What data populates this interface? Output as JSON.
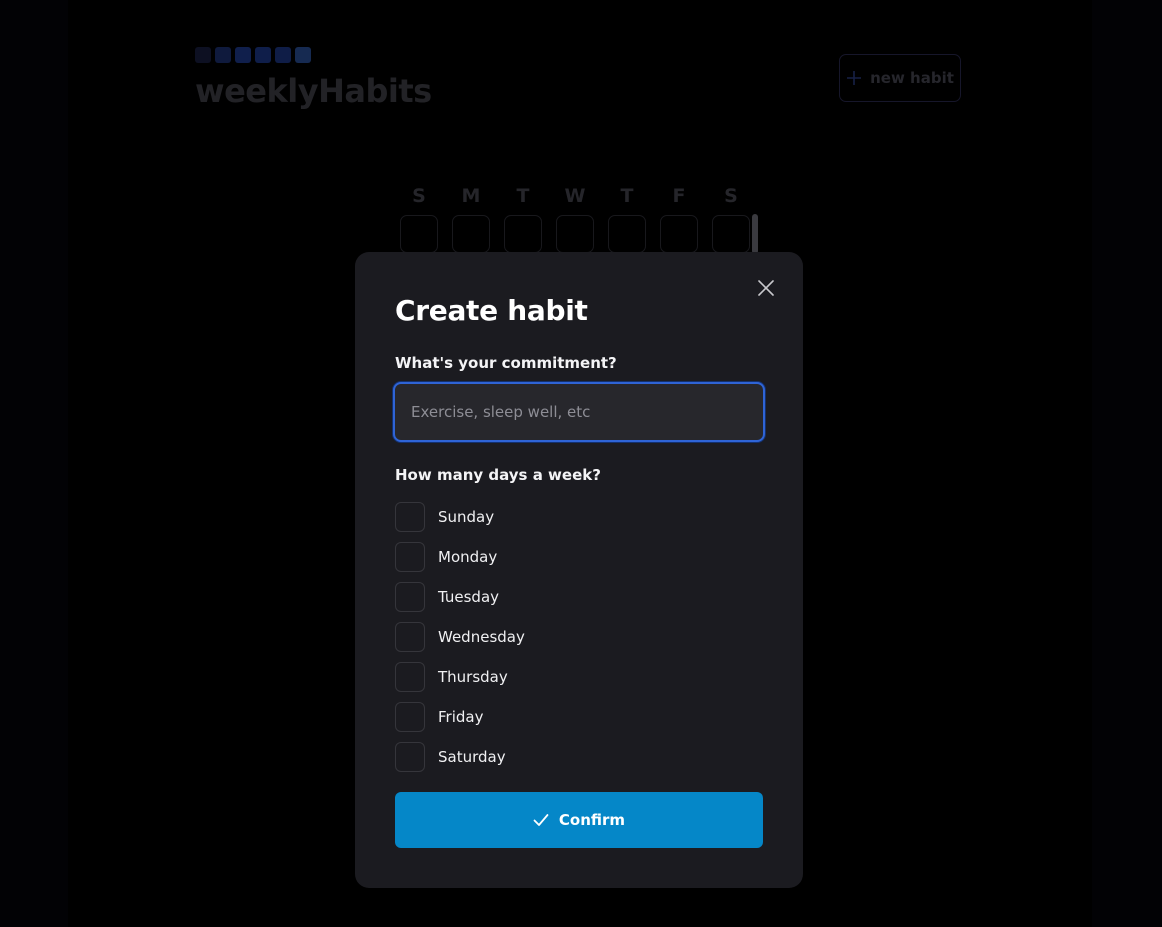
{
  "app": {
    "title": "weeklyHabits",
    "logo_square_colors": [
      "#0d1022",
      "#0f1a3d",
      "#101f4c",
      "#0f1e4a",
      "#0f1d47",
      "#162a51"
    ],
    "new_habit_label": "new habit"
  },
  "week_header": [
    "S",
    "M",
    "T",
    "W",
    "T",
    "F",
    "S"
  ],
  "modal": {
    "title": "Create habit",
    "commitment_label": "What's your commitment?",
    "commitment_value": "",
    "commitment_placeholder": "Exercise, sleep well, etc",
    "days_label": "How many days a week?",
    "days": [
      {
        "label": "Sunday",
        "checked": false
      },
      {
        "label": "Monday",
        "checked": false
      },
      {
        "label": "Tuesday",
        "checked": false
      },
      {
        "label": "Wednesday",
        "checked": false
      },
      {
        "label": "Thursday",
        "checked": false
      },
      {
        "label": "Friday",
        "checked": false
      },
      {
        "label": "Saturday",
        "checked": false
      }
    ],
    "confirm_label": "Confirm"
  },
  "colors": {
    "accent": "#0587c8",
    "input_focus": "#2f64d6",
    "modal_bg": "#1b1b20"
  },
  "icons": {
    "close": "close-icon",
    "confirm": "check-icon",
    "new_habit": "plus-icon"
  }
}
